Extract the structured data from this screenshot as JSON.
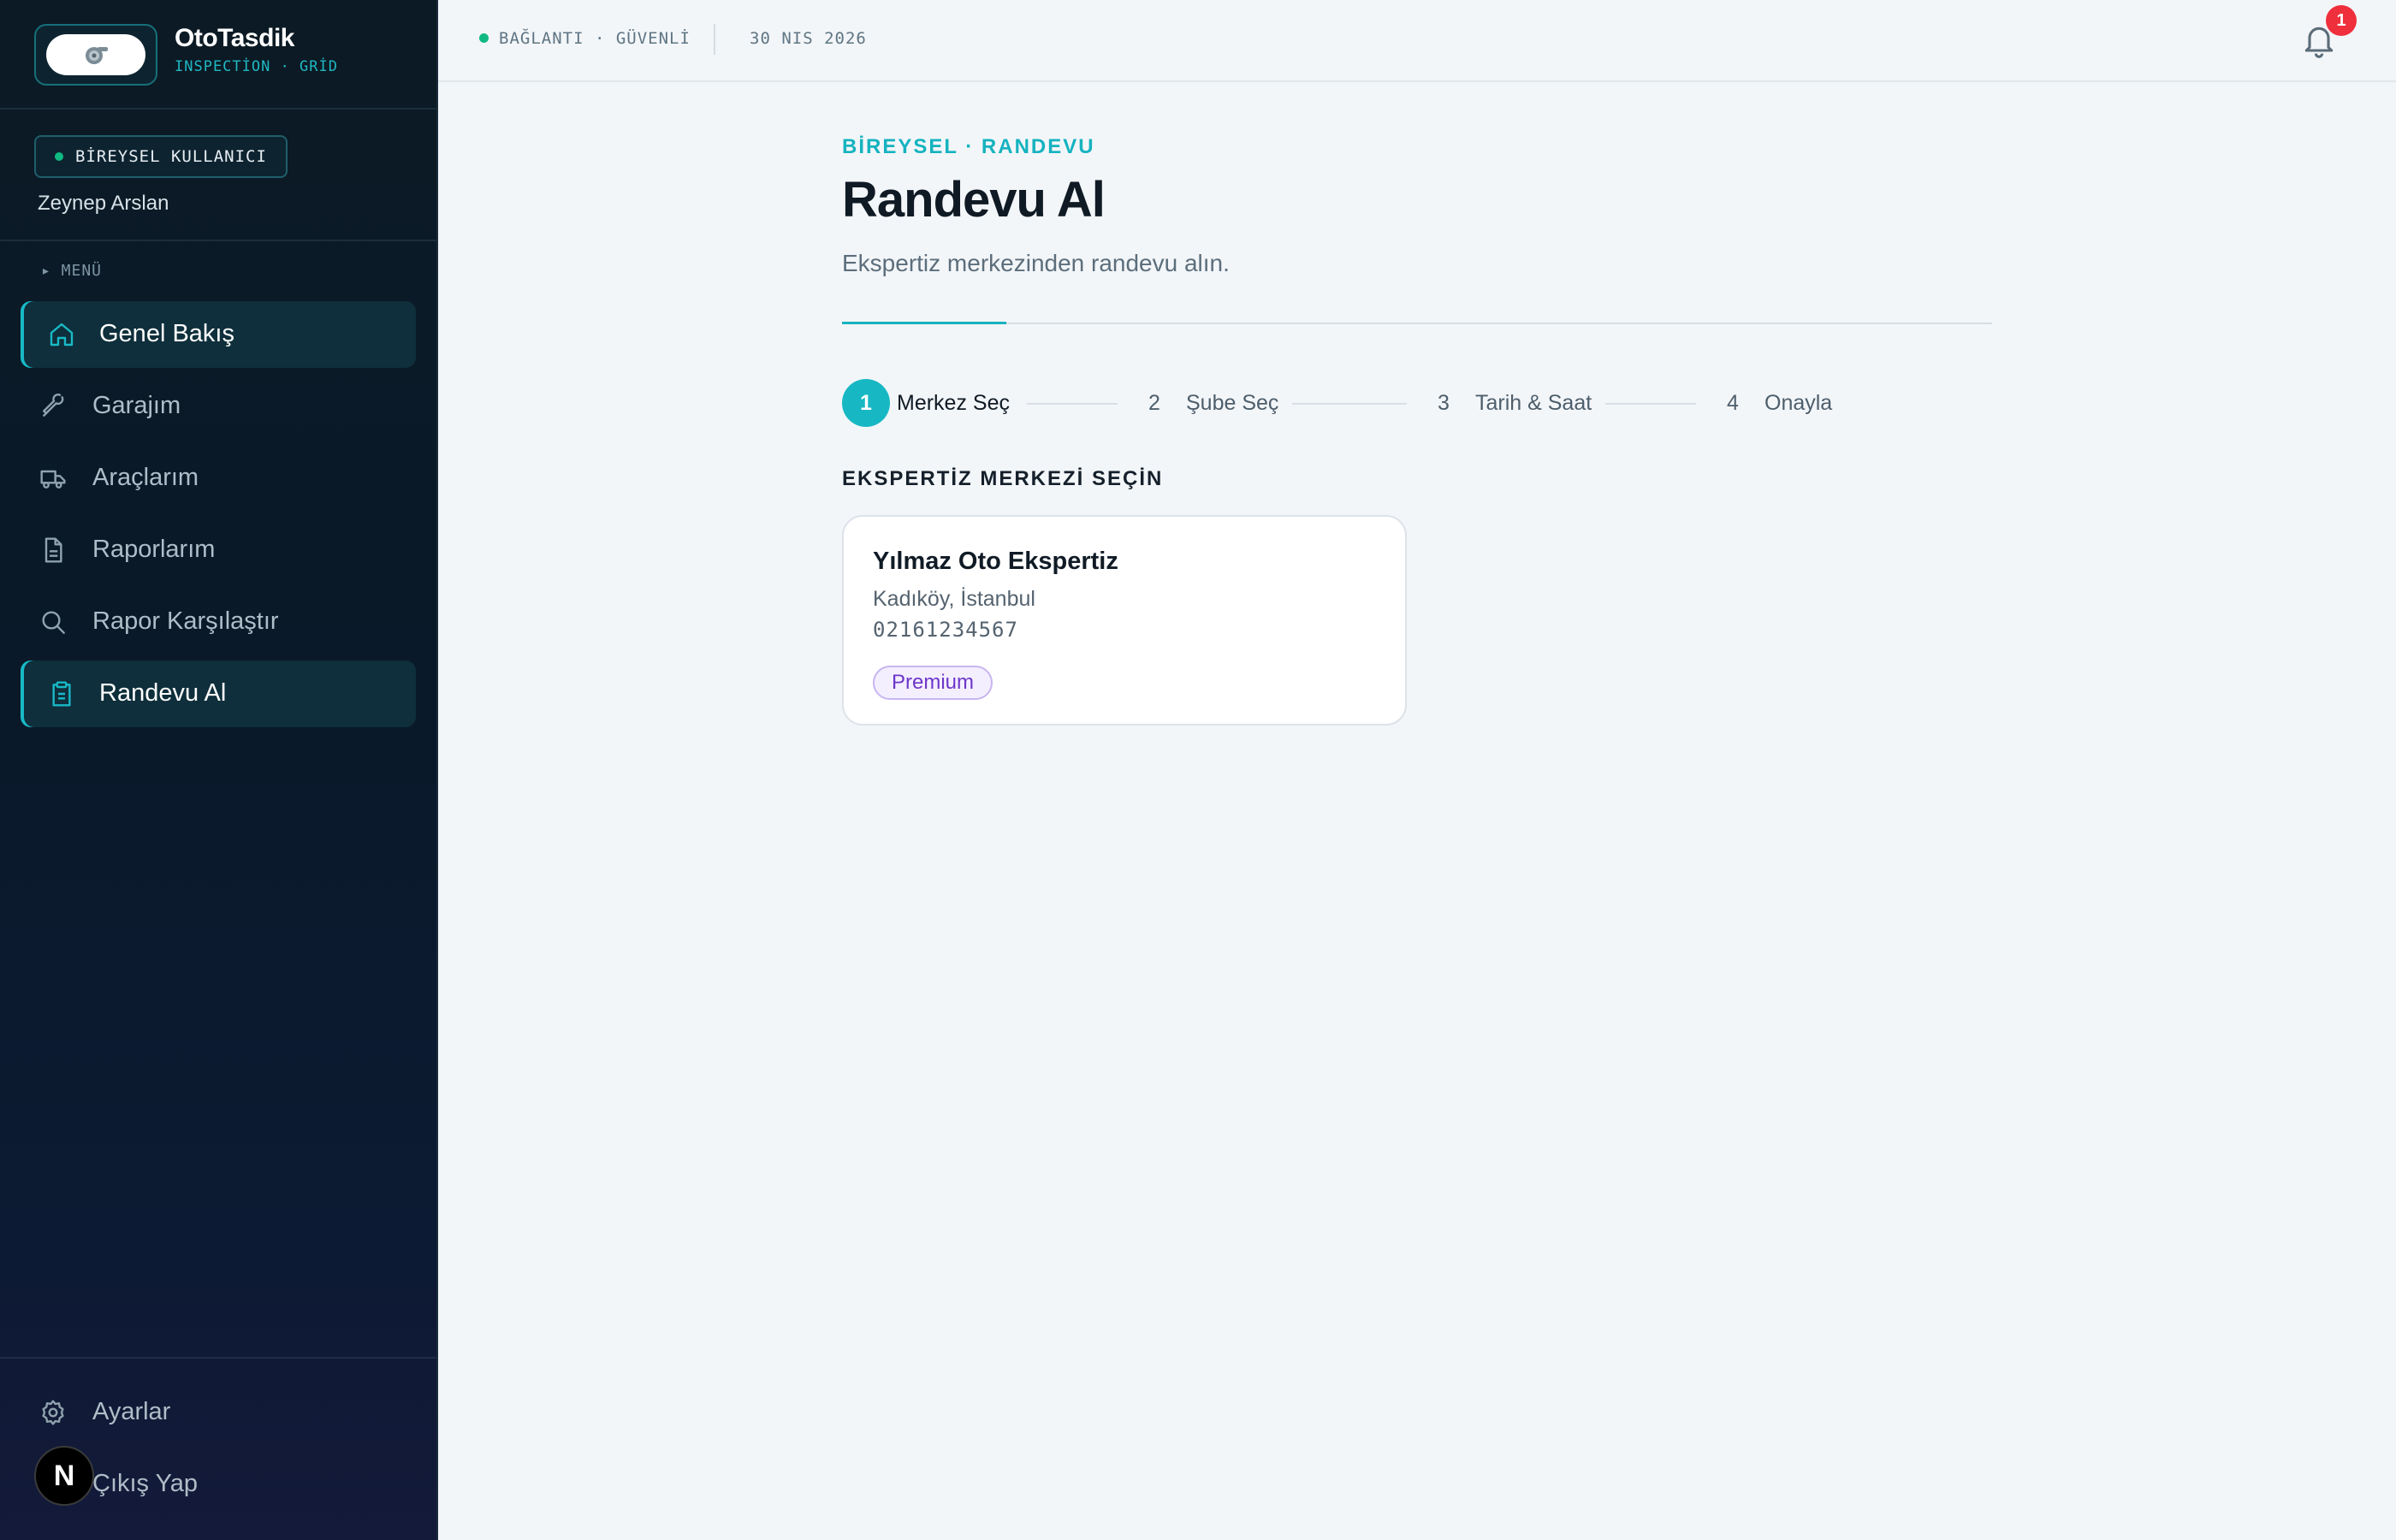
{
  "brand": {
    "name": "OtoTasdik",
    "subtitle": "INSPECTİON · GRİD"
  },
  "user": {
    "role_badge": "BİREYSEL KULLANICI",
    "name": "Zeynep Arslan"
  },
  "sidebar": {
    "menu_label": "▸ MENÜ",
    "items": [
      {
        "label": "Genel Bakış",
        "icon": "home-icon",
        "active": true
      },
      {
        "label": "Garajım",
        "icon": "wrench-icon",
        "active": false
      },
      {
        "label": "Araçlarım",
        "icon": "truck-icon",
        "active": false
      },
      {
        "label": "Raporlarım",
        "icon": "document-icon",
        "active": false
      },
      {
        "label": "Rapor Karşılaştır",
        "icon": "search-icon",
        "active": false
      },
      {
        "label": "Randevu Al",
        "icon": "clipboard-icon",
        "active": true
      }
    ],
    "bottom": [
      {
        "label": "Ayarlar",
        "icon": "gear-icon"
      },
      {
        "label": "Çıkış Yap",
        "icon": "logout-icon"
      }
    ],
    "avatar_letter": "N"
  },
  "topbar": {
    "connection": "BAĞLANTI · GÜVENLİ",
    "date": "30 NIS 2026",
    "notification_count": "1"
  },
  "page": {
    "eyebrow": "BİREYSEL · RANDEVU",
    "title": "Randevu Al",
    "description": "Ekspertiz merkezinden randevu alın."
  },
  "steps": [
    {
      "number": "1",
      "label": "Merkez Seç",
      "current": true
    },
    {
      "number": "2",
      "label": "Şube Seç",
      "current": false
    },
    {
      "number": "3",
      "label": "Tarih & Saat",
      "current": false
    },
    {
      "number": "4",
      "label": "Onayla",
      "current": false
    }
  ],
  "section": {
    "title": "EKSPERTİZ MERKEZİ SEÇİN"
  },
  "centers": [
    {
      "name": "Yılmaz Oto Ekspertiz",
      "location": "Kadıköy, İstanbul",
      "phone": "02161234567",
      "tag": "Premium"
    }
  ],
  "colors": {
    "accent": "#17b8c4",
    "sidebar_bg": "#0a1929",
    "status_ok": "#10b981",
    "badge_red": "#ef2f3c",
    "premium_purple": "#6d35c9"
  }
}
